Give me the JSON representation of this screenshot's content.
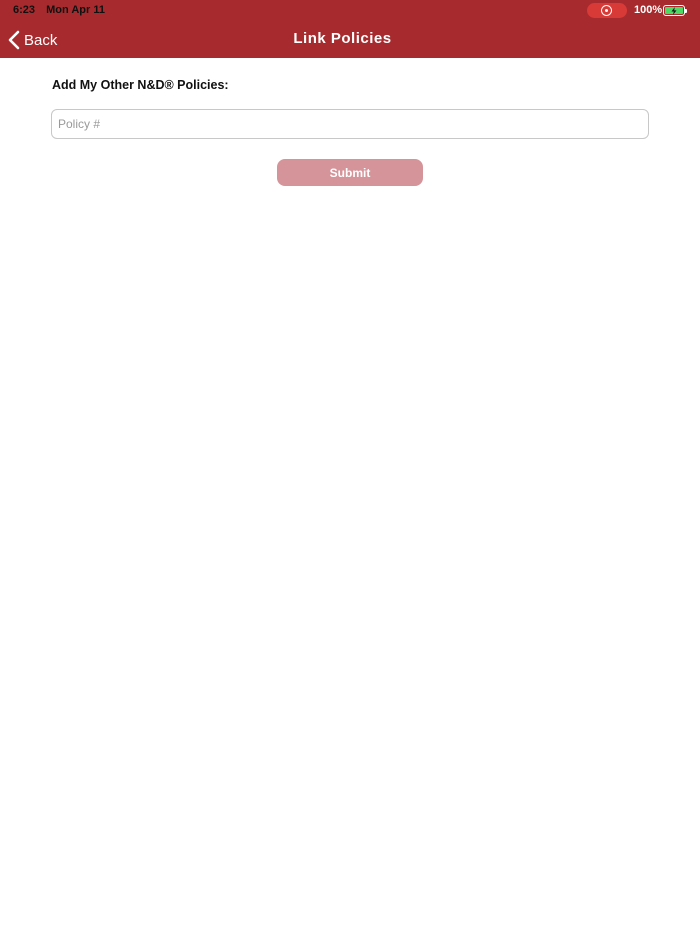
{
  "status_bar": {
    "time": "6:23",
    "date": "Mon Apr 11",
    "battery_percent": "100%"
  },
  "nav": {
    "back_label": "Back",
    "title": "Link Policies"
  },
  "form": {
    "section_label": "Add My Other N&D® Policies:",
    "policy_placeholder": "Policy #",
    "policy_value": "",
    "submit_label": "Submit",
    "submit_enabled": false
  },
  "colors": {
    "header_bg": "#a72b2e",
    "submit_disabled_bg": "#d49499",
    "record_indicator": "#d83a37",
    "battery_fill": "#4cd964"
  },
  "icons": {
    "back": "chevron-left-icon",
    "record": "screen-record-icon",
    "battery": "battery-charging-icon"
  }
}
